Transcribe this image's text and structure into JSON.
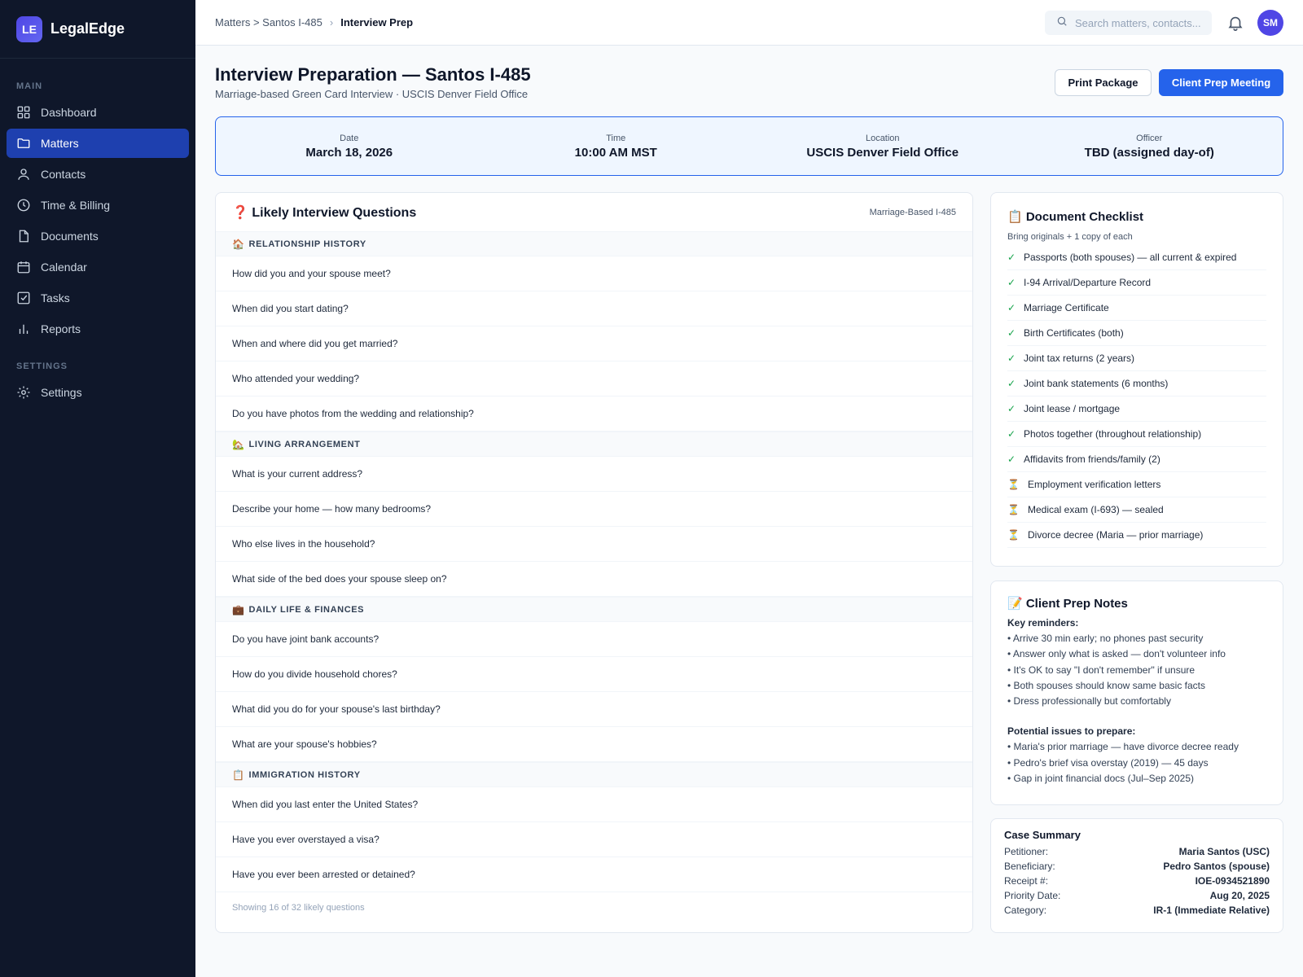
{
  "brand": {
    "logo": "LE",
    "name": "LegalEdge"
  },
  "nav": {
    "main_label": "MAIN",
    "items": [
      {
        "label": "Dashboard",
        "icon": "grid-icon"
      },
      {
        "label": "Matters",
        "icon": "folder-icon",
        "active": true
      },
      {
        "label": "Contacts",
        "icon": "user-icon"
      },
      {
        "label": "Time & Billing",
        "icon": "clock-icon"
      },
      {
        "label": "Documents",
        "icon": "file-icon"
      },
      {
        "label": "Calendar",
        "icon": "calendar-icon"
      },
      {
        "label": "Tasks",
        "icon": "checkbox-icon"
      },
      {
        "label": "Reports",
        "icon": "bar-chart-icon"
      }
    ],
    "settings_label": "SETTINGS",
    "settings_items": [
      {
        "label": "Settings",
        "icon": "gear-icon"
      }
    ]
  },
  "topbar": {
    "breadcrumb": {
      "parent": "Matters > Santos I-485",
      "separator": "›",
      "current": "Interview Prep"
    },
    "search_placeholder": "Search matters, contacts...",
    "avatar": "SM"
  },
  "header": {
    "title": "Interview Preparation — Santos I-485",
    "subtitle": "Marriage-based Green Card Interview · USCIS Denver Field Office",
    "print_button": "Print Package",
    "meeting_button": "Client Prep Meeting"
  },
  "banner": [
    {
      "label": "Date",
      "value": "March 18, 2026"
    },
    {
      "label": "Time",
      "value": "10:00 AM MST"
    },
    {
      "label": "Location",
      "value": "USCIS Denver Field Office"
    },
    {
      "label": "Officer",
      "value": "TBD (assigned day-of)"
    }
  ],
  "questions": {
    "title": "❓ Likely Interview Questions",
    "tag": "Marriage-Based I-485",
    "categories": [
      {
        "emoji": "🏠",
        "name": "RELATIONSHIP HISTORY",
        "items": [
          "How did you and your spouse meet?",
          "When did you start dating?",
          "When and where did you get married?",
          "Who attended your wedding?",
          "Do you have photos from the wedding and relationship?"
        ]
      },
      {
        "emoji": "🏡",
        "name": "LIVING ARRANGEMENT",
        "items": [
          "What is your current address?",
          "Describe your home — how many bedrooms?",
          "Who else lives in the household?",
          "What side of the bed does your spouse sleep on?"
        ]
      },
      {
        "emoji": "💼",
        "name": "DAILY LIFE & FINANCES",
        "items": [
          "Do you have joint bank accounts?",
          "How do you divide household chores?",
          "What did you do for your spouse's last birthday?",
          "What are your spouse's hobbies?"
        ]
      },
      {
        "emoji": "📋",
        "name": "IMMIGRATION HISTORY",
        "items": [
          "When did you last enter the United States?",
          "Have you ever overstayed a visa?",
          "Have you ever been arrested or detained?"
        ]
      }
    ],
    "footer": "Showing 16 of 32 likely questions"
  },
  "checklist": {
    "title": "📋 Document Checklist",
    "subtitle": "Bring originals + 1 copy of each",
    "items": [
      {
        "mark": "✓",
        "done": true,
        "label": "Passports (both spouses) — all current & expired"
      },
      {
        "mark": "✓",
        "done": true,
        "label": "I-94 Arrival/Departure Record"
      },
      {
        "mark": "✓",
        "done": true,
        "label": "Marriage Certificate"
      },
      {
        "mark": "✓",
        "done": true,
        "label": "Birth Certificates (both)"
      },
      {
        "mark": "✓",
        "done": true,
        "label": "Joint tax returns (2 years)"
      },
      {
        "mark": "✓",
        "done": true,
        "label": "Joint bank statements (6 months)"
      },
      {
        "mark": "✓",
        "done": true,
        "label": "Joint lease / mortgage"
      },
      {
        "mark": "✓",
        "done": true,
        "label": "Photos together (throughout relationship)"
      },
      {
        "mark": "✓",
        "done": true,
        "label": "Affidavits from friends/family (2)"
      },
      {
        "mark": "⏳",
        "done": false,
        "label": "Employment verification letters"
      },
      {
        "mark": "⏳",
        "done": false,
        "label": "Medical exam (I-693) — sealed"
      },
      {
        "mark": "⏳",
        "done": false,
        "label": "Divorce decree (Maria — prior marriage)"
      }
    ]
  },
  "notes": {
    "title": "📝 Client Prep Notes",
    "reminders_heading": "Key reminders:",
    "reminders": [
      "• Arrive 30 min early; no phones past security",
      "• Answer only what is asked — don't volunteer info",
      "• It's OK to say \"I don't remember\" if unsure",
      "• Both spouses should know same basic facts",
      "• Dress professionally but comfortably"
    ],
    "issues_heading": "Potential issues to prepare:",
    "issues": [
      "• Maria's prior marriage — have divorce decree ready",
      "• Pedro's brief visa overstay (2019) — 45 days",
      "• Gap in joint financial docs (Jul–Sep 2025)"
    ]
  },
  "summary": {
    "title": "Case Summary",
    "rows": [
      {
        "k": "Petitioner:",
        "v": "Maria Santos (USC)"
      },
      {
        "k": "Beneficiary:",
        "v": "Pedro Santos (spouse)"
      },
      {
        "k": "Receipt #:",
        "v": "IOE-0934521890"
      },
      {
        "k": "Priority Date:",
        "v": "Aug 20, 2025"
      },
      {
        "k": "Category:",
        "v": "IR-1 (Immediate Relative)"
      }
    ]
  }
}
